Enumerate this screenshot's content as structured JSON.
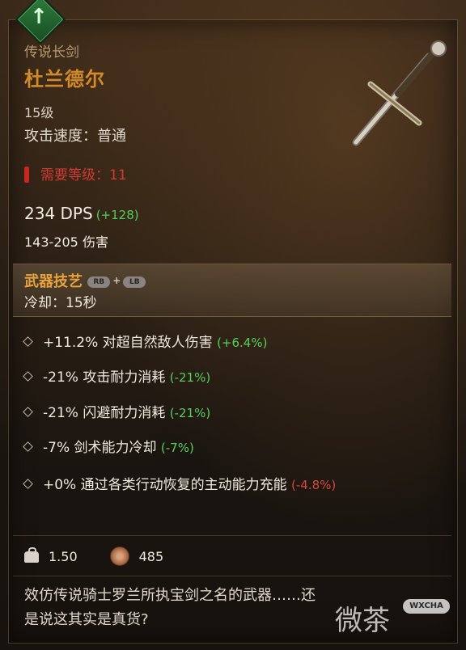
{
  "item": {
    "type": "传说长剑",
    "name": "杜兰德尔",
    "level": "15级",
    "attack_speed": "攻击速度：普通",
    "requirement": "需要等级：11",
    "dps_value": "234 DPS",
    "dps_delta": "(+128)",
    "damage": "143-205 伤害"
  },
  "weapon_skill": {
    "title": "武器技艺",
    "button_1": "RB",
    "plus": "+",
    "button_2": "LB",
    "cooldown": "冷却：15秒"
  },
  "affixes": [
    {
      "text": "+11.2% 对超自然敌人伤害",
      "delta": "(+6.4%)",
      "color": "green"
    },
    {
      "text": "-21% 攻击耐力消耗",
      "delta": "(-21%)",
      "color": "green"
    },
    {
      "text": "-21% 闪避耐力消耗",
      "delta": "(-21%)",
      "color": "green"
    },
    {
      "text": "-7% 剑术能力冷却",
      "delta": "(-7%)",
      "color": "green"
    },
    {
      "text": "+0% 通过各类行动恢复的主动能力充能",
      "delta": "(-4.8%)",
      "color": "red"
    }
  ],
  "stats": {
    "weight": "1.50",
    "value": "485"
  },
  "description": "效仿传说骑士罗兰所执宝剑之名的武器……还是说这其实是真货?",
  "watermark": {
    "text": "微茶",
    "chip": "WXCHA"
  },
  "colors": {
    "legendary_name": "#d28a2b",
    "positive": "#55d15a",
    "negative": "#d9463d",
    "requirement": "#d23a32"
  },
  "icons": {
    "upgrade_badge": "arrow-up-icon",
    "weapon": "longsword-icon",
    "weight": "weight-icon",
    "gold": "coin-icon"
  }
}
